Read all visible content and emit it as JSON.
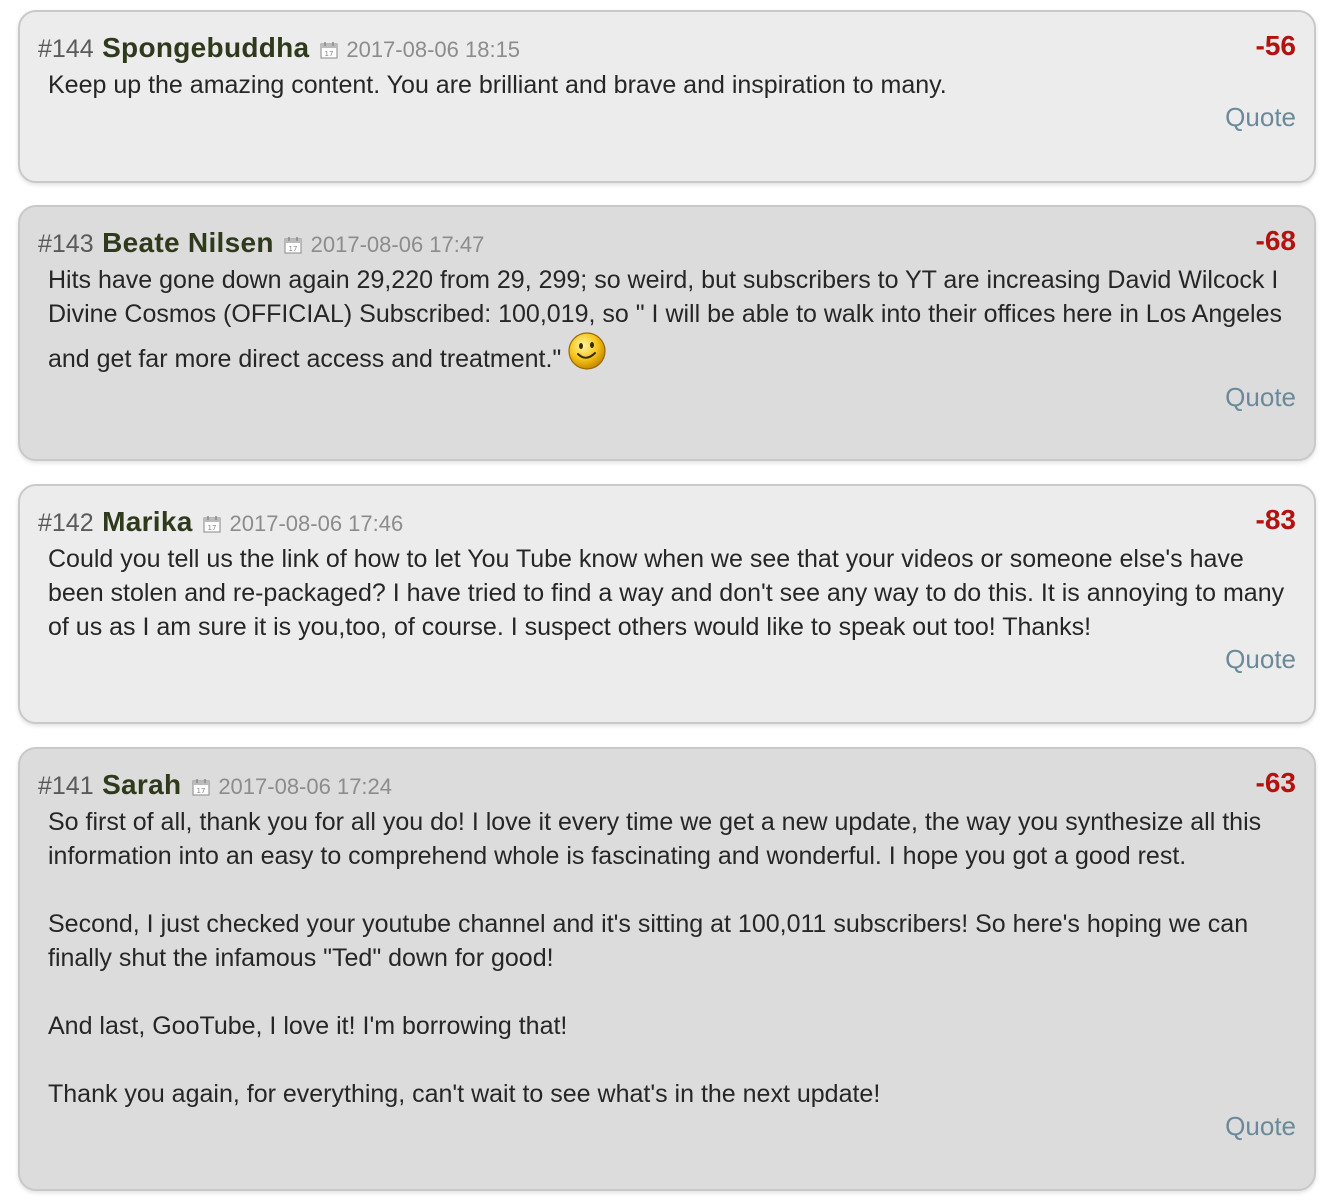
{
  "comments": [
    {
      "num": "#144",
      "author": "Spongebuddha",
      "date": "2017-08-06 18:15",
      "score": "-56",
      "paragraphs": [
        "Keep up the amazing content. You are brilliant and brave and inspiration to many."
      ],
      "quote_label": "Quote"
    },
    {
      "num": "#143",
      "author": "Beate Nilsen",
      "date": "2017-08-06 17:47",
      "score": "-68",
      "paragraphs": [
        "Hits have gone down again 29,220 from 29, 299; so weird, but subscribers to YT are increasing David Wilcock I Divine Cosmos (OFFICIAL) Subscribed: 100,019, so \" I will be able to walk into their offices here in Los Angeles and get far more direct access and treatment.\""
      ],
      "quote_label": "Quote"
    },
    {
      "num": "#142",
      "author": "Marika",
      "date": "2017-08-06 17:46",
      "score": "-83",
      "paragraphs": [
        "Could you tell us the link of how to let You Tube know when we see that your videos or someone else's have been stolen and re-packaged? I have tried to find a way and don't see any way to do this. It is annoying to many of us as I am sure it is you,too, of course. I suspect others would like to speak out too! Thanks!"
      ],
      "quote_label": "Quote"
    },
    {
      "num": "#141",
      "author": "Sarah",
      "date": "2017-08-06 17:24",
      "score": "-63",
      "paragraphs": [
        "So first of all, thank you for all you do! I love it every time we get a new update, the way you synthesize all this information into an easy to comprehend whole is fascinating and wonderful. I hope you got a good rest.",
        "Second, I just checked your youtube channel and it's sitting at 100,011 subscribers! So here's hoping we can finally shut the infamous \"Ted\" down for good!",
        "And last, GooTube, I love it! I'm borrowing that!",
        "Thank you again, for everything, can't wait to see what's in the next update!"
      ],
      "quote_label": "Quote"
    }
  ],
  "icons": {
    "calendar": "calendar-icon",
    "smiley": "smiley-icon"
  },
  "colors": {
    "score": "#b3120f",
    "author": "#2f3a1c",
    "quote": "#6b8a99",
    "date": "#8c8c8c"
  }
}
